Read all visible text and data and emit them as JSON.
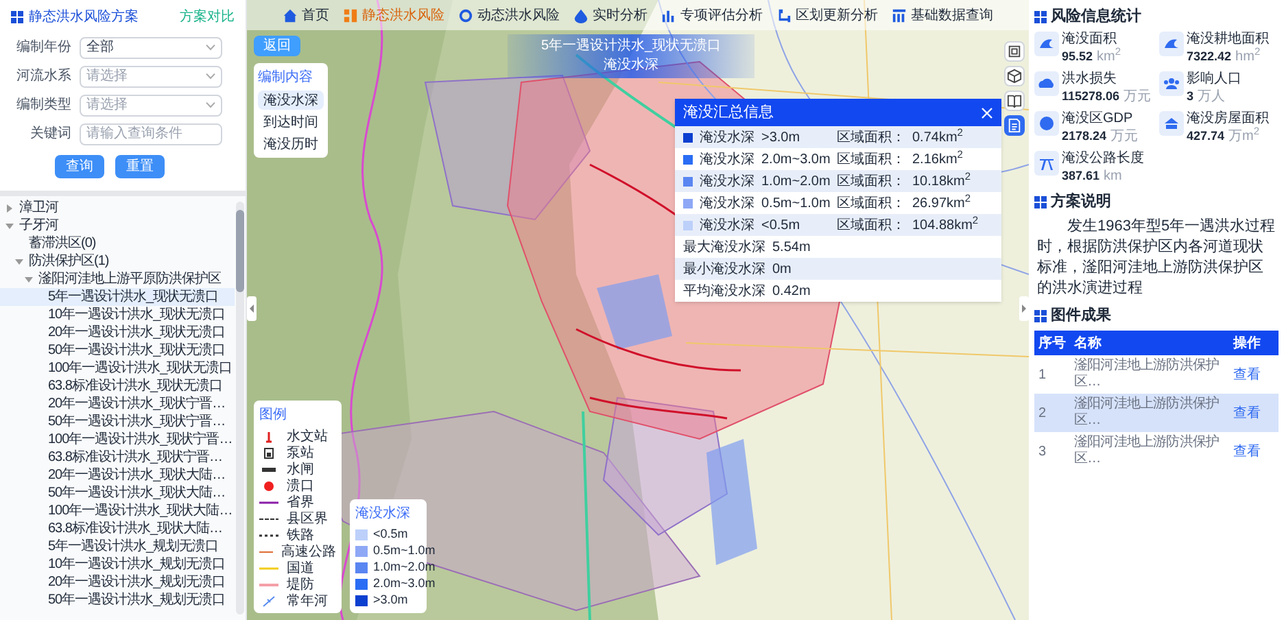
{
  "left_panel": {
    "title": "静态洪水风险方案",
    "compare_link": "方案对比",
    "filters": [
      {
        "kind": "select",
        "label": "编制年份",
        "value": "全部"
      },
      {
        "kind": "select",
        "label": "河流水系",
        "placeholder": "请选择"
      },
      {
        "kind": "select",
        "label": "编制类型",
        "placeholder": "请选择"
      },
      {
        "kind": "text",
        "label": "关键词",
        "placeholder": "请输入查询条件"
      }
    ],
    "buttons": [
      "查询",
      "重置"
    ],
    "tree": [
      {
        "label": "漳卫河",
        "expanded": false,
        "selected": false
      },
      {
        "label": "子牙河",
        "expanded": true,
        "selected": false,
        "children": [
          {
            "label": "蓄滞洪区(0)",
            "selected": false
          },
          {
            "label": "防洪保护区(1)",
            "expanded": true,
            "selected": false,
            "children": [
              {
                "label": "滏阳河洼地上游平原防洪保护区",
                "expanded": true,
                "selected": false,
                "children": [
                  {
                    "label": "5年一遇设计洪水_现状无溃口",
                    "selected": true
                  },
                  {
                    "label": "10年一遇设计洪水_现状无溃口",
                    "selected": false
                  },
                  {
                    "label": "20年一遇设计洪水_现状无溃口",
                    "selected": false
                  },
                  {
                    "label": "50年一遇设计洪水_现状无溃口",
                    "selected": false
                  },
                  {
                    "label": "100年一遇设计洪水_现状无溃口",
                    "selected": false
                  },
                  {
                    "label": "63.8标准设计洪水_现状无溃口",
                    "selected": false
                  },
                  {
                    "label": "20年一遇设计洪水_现状宁晋…",
                    "selected": false
                  },
                  {
                    "label": "50年一遇设计洪水_现状宁晋…",
                    "selected": false
                  },
                  {
                    "label": "100年一遇设计洪水_现状宁晋…",
                    "selected": false
                  },
                  {
                    "label": "63.8标准设计洪水_现状宁晋…",
                    "selected": false
                  },
                  {
                    "label": "20年一遇设计洪水_现状大陆…",
                    "selected": false
                  },
                  {
                    "label": "50年一遇设计洪水_现状大陆…",
                    "selected": false
                  },
                  {
                    "label": "100年一遇设计洪水_现状大陆…",
                    "selected": false
                  },
                  {
                    "label": "63.8标准设计洪水_现状大陆…",
                    "selected": false
                  },
                  {
                    "label": "5年一遇设计洪水_规划无溃口",
                    "selected": false
                  },
                  {
                    "label": "10年一遇设计洪水_规划无溃口",
                    "selected": false
                  },
                  {
                    "label": "20年一遇设计洪水_规划无溃口",
                    "selected": false
                  },
                  {
                    "label": "50年一遇设计洪水_规划无溃口",
                    "selected": false
                  }
                ]
              }
            ]
          }
        ]
      }
    ]
  },
  "nav": [
    {
      "label": "首页",
      "selected": false
    },
    {
      "label": "静态洪水风险",
      "selected": true
    },
    {
      "label": "动态洪水风险",
      "selected": false
    },
    {
      "label": "实时分析",
      "selected": false
    },
    {
      "label": "专项评估分析",
      "selected": false
    },
    {
      "label": "区划更新分析",
      "selected": false
    },
    {
      "label": "基础数据查询",
      "selected": false
    }
  ],
  "back_button": "返回",
  "layer_panel": {
    "title": "编制内容",
    "items": [
      {
        "label": "淹没水深",
        "selected": true
      },
      {
        "label": "到达时间",
        "selected": false
      },
      {
        "label": "淹没历时",
        "selected": false
      }
    ]
  },
  "map_title": {
    "line_1": "5年一遇设计洪水_现状无溃口",
    "line_2": "淹没水深"
  },
  "map_tools": [
    {
      "selected": false
    },
    {
      "selected": false
    },
    {
      "selected": false
    },
    {
      "selected": true
    }
  ],
  "summary_popup": {
    "title": "淹没汇总信息",
    "depth_rows": [
      {
        "color": "#0b3fd0",
        "label": "淹没水深",
        "range": ">3.0m",
        "area_label": "区域面积：",
        "area": "0.74km$^{2}$"
      },
      {
        "color": "#2a6df4",
        "label": "淹没水深",
        "range": "2.0m~3.0m",
        "area_label": "区域面积：",
        "area": "2.16km$^{2}$"
      },
      {
        "color": "#5a86f2",
        "label": "淹没水深",
        "range": "1.0m~2.0m",
        "area_label": "区域面积：",
        "area": "10.18km$^{2}$"
      },
      {
        "color": "#8ea8f6",
        "label": "淹没水深",
        "range": "0.5m~1.0m",
        "area_label": "区域面积：",
        "area": "26.97km$^{2}$"
      },
      {
        "color": "#bcd0fa",
        "label": "淹没水深",
        "range": "<0.5m",
        "area_label": "区域面积：",
        "area": "104.88km$^{2}$"
      }
    ],
    "stat_rows": [
      {
        "label": "最大淹没水深",
        "value": "5.54m"
      },
      {
        "label": "最小淹没水深",
        "value": "0m"
      },
      {
        "label": "平均淹没水深",
        "value": "0.42m"
      }
    ]
  },
  "legend": {
    "title": "图例",
    "items": [
      {
        "kind": "station",
        "label": "水文站"
      },
      {
        "kind": "pump",
        "label": "泵站"
      },
      {
        "kind": "sluice",
        "label": "水闸"
      },
      {
        "kind": "breach",
        "label": "溃口"
      },
      {
        "kind": "province",
        "label": "省界"
      },
      {
        "kind": "county",
        "label": "县区界"
      },
      {
        "kind": "railway",
        "label": "铁路"
      },
      {
        "kind": "highway",
        "label": "高速公路"
      },
      {
        "kind": "national_road",
        "label": "国道"
      },
      {
        "kind": "levee",
        "label": "堤防"
      },
      {
        "kind": "river",
        "label": "常年河"
      }
    ]
  },
  "depth_legend": {
    "title": "淹没水深",
    "items": [
      {
        "color": "#bcd0fa",
        "label": "<0.5m"
      },
      {
        "color": "#8ea8f6",
        "label": "0.5m~1.0m"
      },
      {
        "color": "#5a86f2",
        "label": "1.0m~2.0m"
      },
      {
        "color": "#2a6df4",
        "label": "2.0m~3.0m"
      },
      {
        "color": "#0b3fd0",
        "label": ">3.0m"
      }
    ]
  },
  "right_panel": {
    "stats_title": "风险信息统计",
    "stats": [
      {
        "label": "淹没面积",
        "value": "95.52",
        "unit": "km$^{2}$"
      },
      {
        "label": "淹没耕地面积",
        "value": "7322.42",
        "unit": "hm$^{2}$"
      },
      {
        "label": "洪水损失",
        "value": "115278.06",
        "unit": "万元"
      },
      {
        "label": "影响人口",
        "value": "3",
        "unit": "万人"
      },
      {
        "label": "淹没区GDP",
        "value": "2178.24",
        "unit": "万元"
      },
      {
        "label": "淹没房屋面积",
        "value": "427.74",
        "unit": "万m$^{2}$"
      },
      {
        "label": "淹没公路长度",
        "value": "387.61",
        "unit": "km"
      }
    ],
    "description_title": "方案说明",
    "description": "发生1963年型5年一遇洪水过程时，根据防洪保护区内各河道现状标准，滏阳河洼地上游防洪保护区的洪水演进过程",
    "results_title": "图件成果",
    "table": {
      "columns": [
        "序号",
        "名称",
        "操作"
      ],
      "rows": [
        {
          "cells": [
            "1",
            "滏阳河洼地上游防洪保护区…",
            "查看"
          ],
          "selected": false
        },
        {
          "cells": [
            "2",
            "滏阳河洼地上游防洪保护区…",
            "查看"
          ],
          "selected": true
        },
        {
          "cells": [
            "3",
            "滏阳河洼地上游防洪保护区…",
            "查看"
          ],
          "selected": false
        }
      ]
    }
  }
}
